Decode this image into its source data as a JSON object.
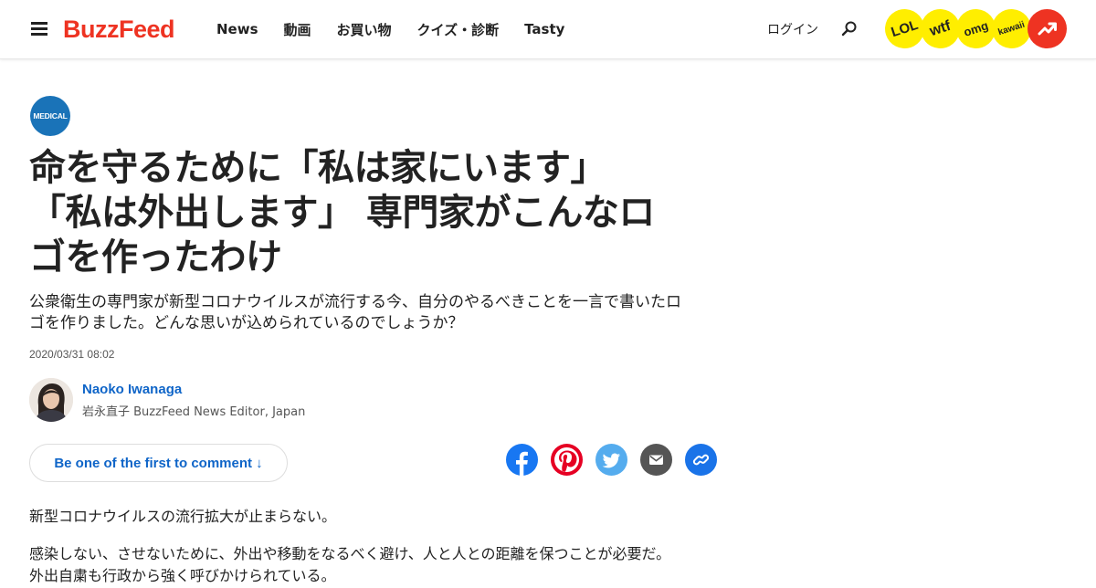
{
  "header": {
    "logo": "BuzzFeed",
    "nav": [
      "News",
      "動画",
      "お買い物",
      "クイズ・診断",
      "Tasty"
    ],
    "login": "ログイン",
    "badges": [
      "LOL",
      "wtf",
      "omg",
      "kawaii"
    ],
    "colors": {
      "brand": "#ee3322",
      "badge_yellow": "#ffee00"
    }
  },
  "article": {
    "category_badge": "MEDICAL",
    "headline_lines": [
      "命を守るために「私は家にいます」",
      "「私は外出します」 専門家がこんなロ",
      "ゴを作ったわけ"
    ],
    "dek_lines": [
      "公衆衛生の専門家が新型コロナウイルスが流行する今、自分のやるべきことを一言で書いたロ",
      "ゴを作りました。どんな思いが込められているのでしょうか？"
    ],
    "timestamp": "2020/03/31 08:02",
    "author": {
      "name": "Naoko Iwanaga",
      "title": "岩永直子 BuzzFeed News Editor, Japan"
    },
    "comment_button": "Be one of the first to comment ↓",
    "share_icons": [
      "facebook-icon",
      "pinterest-icon",
      "twitter-icon",
      "email-icon",
      "link-icon"
    ],
    "share_colors": {
      "facebook": "#1877f2",
      "pinterest": "#e60023",
      "twitter": "#55acee",
      "email": "#555555",
      "link": "#1a73e8"
    },
    "body": [
      "新型コロナウイルスの流行拡大が止まらない。",
      "感染しない、させないために、外出や移動をなるべく避け、人と人との距離を保つことが必要だ。",
      "外出自粛も行政から強く呼びかけられている。"
    ]
  }
}
